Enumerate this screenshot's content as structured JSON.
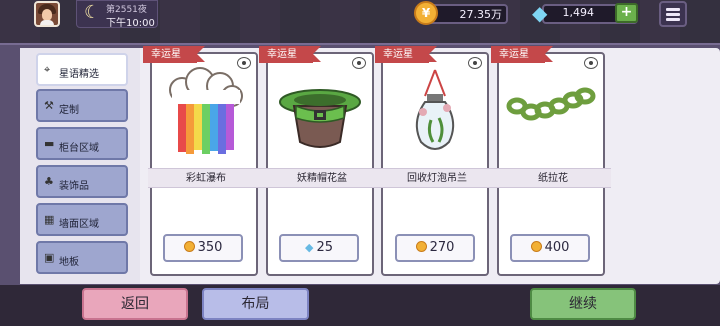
{
  "topbar": {
    "day_label": "第2551夜",
    "time_label": "下午10:00",
    "coins": "27.35万",
    "gems": "1,494",
    "plus_label": "+"
  },
  "sidebar": {
    "items": [
      {
        "label": "星语精选",
        "icon": "location-pin-icon"
      },
      {
        "label": "定制",
        "icon": "hammer-icon"
      },
      {
        "label": "柜台区域",
        "icon": "counter-icon"
      },
      {
        "label": "装饰品",
        "icon": "plant-icon"
      },
      {
        "label": "墙面区域",
        "icon": "wall-icon"
      },
      {
        "label": "地板",
        "icon": "floor-icon"
      }
    ]
  },
  "cards": [
    {
      "badge": "幸运星",
      "name": "彩虹瀑布",
      "price": "350",
      "currency": "coin"
    },
    {
      "badge": "幸运星",
      "name": "妖精帽花盆",
      "price": "25",
      "currency": "gem"
    },
    {
      "badge": "幸运星",
      "name": "回收灯泡吊兰",
      "price": "270",
      "currency": "coin"
    },
    {
      "badge": "幸运星",
      "name": "纸拉花",
      "price": "400",
      "currency": "coin"
    }
  ],
  "bottom": {
    "back_label": "返回",
    "layout_label": "布局",
    "continue_label": "继续"
  }
}
